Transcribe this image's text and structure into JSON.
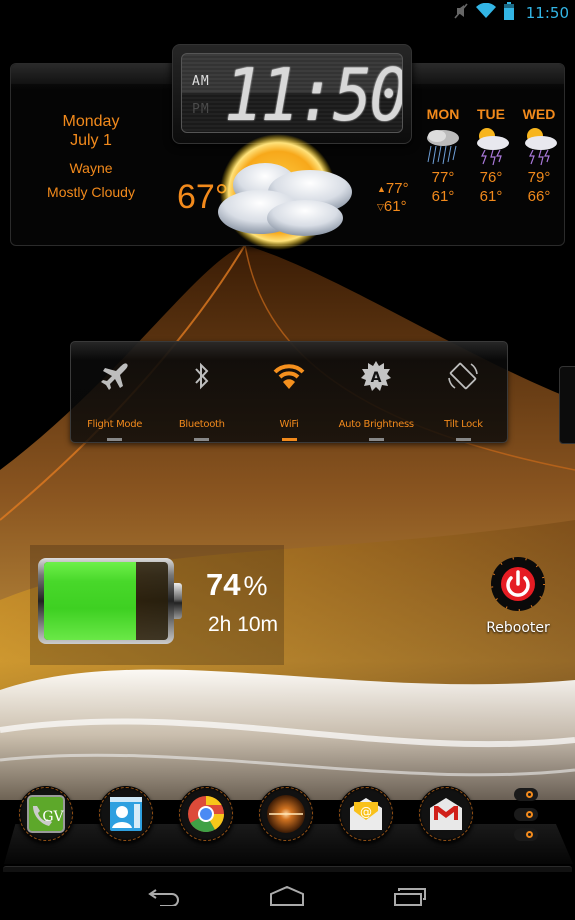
{
  "status_bar": {
    "time": "11:50",
    "icons": [
      "mute-icon",
      "wifi-icon",
      "battery-icon"
    ],
    "accent_color": "#33b5e5"
  },
  "weather_widget": {
    "day": "Monday",
    "date": "July 1",
    "city": "Wayne",
    "condition": "Mostly Cloudy",
    "clock": {
      "time": "11:50",
      "am_label": "AM",
      "pm_label": "PM",
      "active_period": "AM"
    },
    "current_temp": "67°",
    "high": "77°",
    "low": "61°",
    "high_arrow": "▲",
    "low_arrow": "▽",
    "current_icon": "partly-cloudy-icon",
    "forecast": [
      {
        "day": "MON",
        "icon": "rain-icon",
        "high": "77°",
        "low": "61°"
      },
      {
        "day": "TUE",
        "icon": "thunderstorm-icon",
        "high": "76°",
        "low": "61°"
      },
      {
        "day": "WED",
        "icon": "thunderstorm-icon",
        "high": "79°",
        "low": "66°"
      }
    ],
    "accent_color": "#f28a1c"
  },
  "toggles": [
    {
      "label": "Flight Mode",
      "icon": "airplane-icon",
      "on": false
    },
    {
      "label": "Bluetooth",
      "icon": "bluetooth-icon",
      "on": false
    },
    {
      "label": "WiFi",
      "icon": "wifi-icon",
      "on": true
    },
    {
      "label": "Auto Brightness",
      "icon": "auto-brightness-icon",
      "on": false
    },
    {
      "label": "Tilt Lock",
      "icon": "rotate-icon",
      "on": false
    }
  ],
  "battery": {
    "percent_value": "74",
    "percent_unit": "%",
    "level": 0.74,
    "time_remaining": "2h 10m",
    "fill_color": "#48d82a"
  },
  "rebooter": {
    "label": "Rebooter",
    "icon": "power-icon"
  },
  "dock": {
    "apps": [
      {
        "name": "Google Voice",
        "icon": "google-voice-icon"
      },
      {
        "name": "Contacts",
        "icon": "contacts-icon"
      },
      {
        "name": "Chrome",
        "icon": "chrome-icon"
      },
      {
        "name": "Launcher Orb",
        "icon": "orb-icon"
      },
      {
        "name": "Email",
        "icon": "email-icon"
      },
      {
        "name": "Gmail",
        "icon": "gmail-icon"
      }
    ],
    "menu_icon": "dock-menu-icon"
  },
  "nav_bar": {
    "buttons": [
      "back",
      "home",
      "recents"
    ]
  }
}
